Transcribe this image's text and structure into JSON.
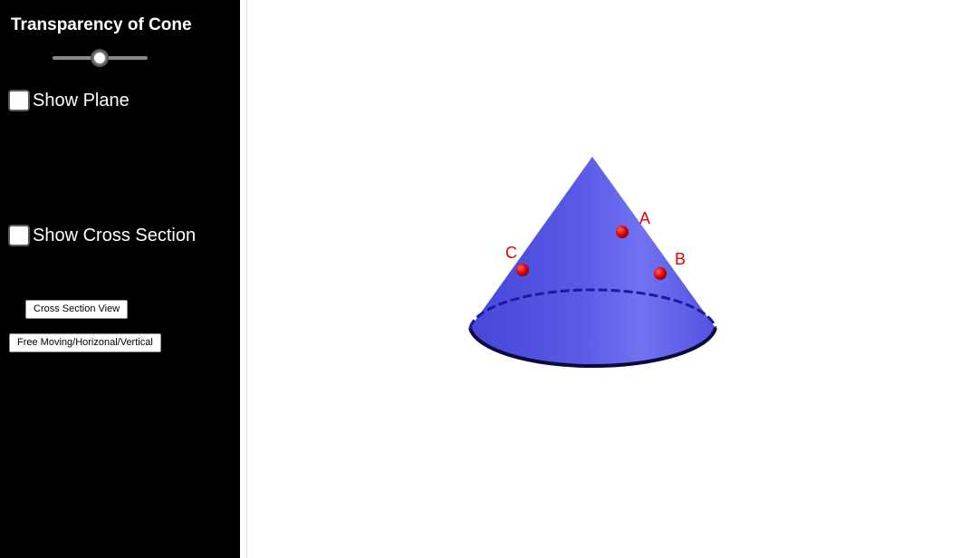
{
  "sidebar": {
    "slider": {
      "title": "Transparency of Cone",
      "value_fraction": 0.5
    },
    "checkboxes": [
      {
        "label": "Show Plane",
        "checked": false
      },
      {
        "label": "Show Cross Section",
        "checked": false
      }
    ],
    "buttons": {
      "cross_section_view": "Cross Section View",
      "free_moving": "Free Moving/Horizonal/Vertical"
    }
  },
  "scene": {
    "points": [
      {
        "label": "A"
      },
      {
        "label": "B"
      },
      {
        "label": "C"
      }
    ],
    "colors": {
      "cone": "#5a5ae6",
      "cone_highlight": "#7b7bf5",
      "base_edge": "#0a0a3c",
      "dashed_edge": "#1a1aa0",
      "point": "#e00000",
      "label": "#e00000",
      "panel": "#000000"
    }
  }
}
